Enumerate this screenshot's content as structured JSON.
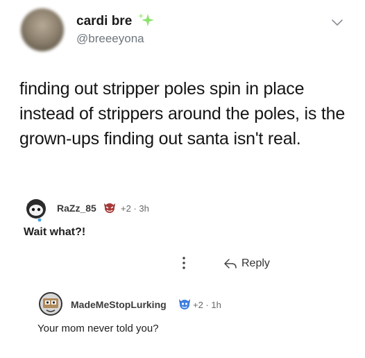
{
  "tweet": {
    "display_name": "cardi bre",
    "handle": "@breeeyona",
    "text": "finding out stripper poles spin in place instead of strippers around the poles, is the grown-ups finding out santa isn't real.",
    "name_emoji_icon": "sparkle-icon",
    "menu_icon": "chevron-down-icon"
  },
  "comments": [
    {
      "username": "RaZz_85",
      "badge_icon": "demon-mascot-badge-icon",
      "meta": "+2 · 3h",
      "text": "Wait what?!"
    },
    {
      "username": "MadeMeStopLurking",
      "badge_icon": "mascot-badge-icon",
      "meta": "+2 · 1h",
      "text": "Your mom never told you?"
    }
  ],
  "actions": {
    "reply_label": "Reply",
    "more_icon": "vertical-dots-icon",
    "reply_icon": "reply-arrow-icon"
  },
  "colors": {
    "handle": "#6e767d",
    "text": "#141414",
    "badge_red": "#c0392b",
    "badge_blue": "#2e6fd1",
    "sparkle_green": "#7ed957"
  }
}
